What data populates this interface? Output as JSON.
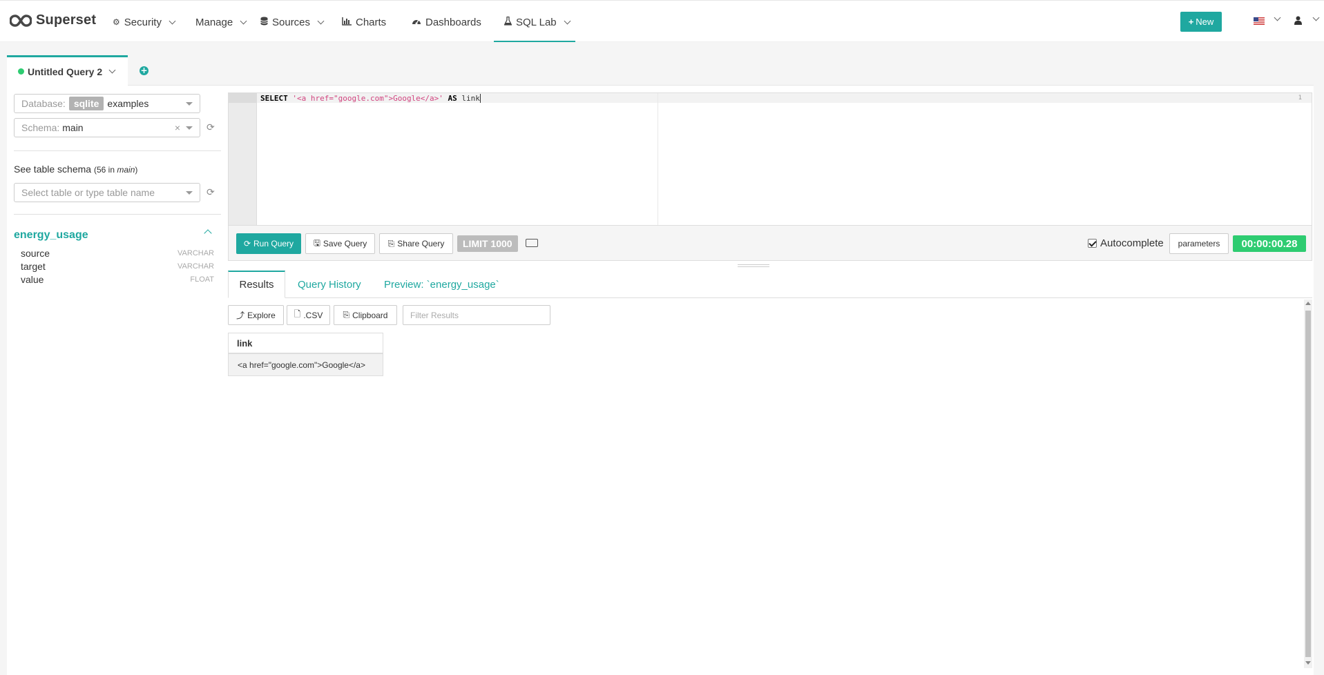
{
  "navbar": {
    "brand": "Superset",
    "items": [
      {
        "label": "Security",
        "icon": "cogs-icon"
      },
      {
        "label": "Manage",
        "icon": ""
      },
      {
        "label": "Sources",
        "icon": "database-icon"
      },
      {
        "label": "Charts",
        "icon": "bar-chart-icon"
      },
      {
        "label": "Dashboards",
        "icon": "dashboard-icon"
      },
      {
        "label": "SQL Lab",
        "icon": "flask-icon"
      }
    ],
    "new_label": "New",
    "accent_color": "#1fa8a0"
  },
  "query_tab": {
    "title": "Untitled Query 2",
    "status_color": "#2ecc71"
  },
  "left_panel": {
    "database_placeholder": "Database:",
    "database_backend": "sqlite",
    "database_name": "examples",
    "schema_placeholder": "Schema:",
    "schema_value": "main",
    "schema_clear": "×",
    "see_table_schema": "See table schema",
    "table_count": "56",
    "table_count_in": "in",
    "table_count_schema": "main",
    "table_select_placeholder": "Select table or type table name",
    "table": {
      "name": "energy_usage",
      "columns": [
        {
          "name": "source",
          "type": "VARCHAR"
        },
        {
          "name": "target",
          "type": "VARCHAR"
        },
        {
          "name": "value",
          "type": "FLOAT"
        }
      ]
    }
  },
  "editor": {
    "line_number": "1",
    "code": {
      "kw1": "SELECT",
      "string": "'<a href=\"google.com\">Google</a>'",
      "kw2": "AS",
      "ident": "link"
    }
  },
  "toolbar": {
    "run_label": "Run Query",
    "save_label": "Save Query",
    "share_label": "Share Query",
    "limit_label": "LIMIT 1000",
    "autocomplete_label": "Autocomplete",
    "autocomplete_checked": true,
    "parameters_label": "parameters",
    "timer": "00:00:00.28"
  },
  "results": {
    "tabs": [
      "Results",
      "Query History",
      "Preview: `energy_usage`"
    ],
    "explore_label": "Explore",
    "csv_label": ".CSV",
    "clipboard_label": "Clipboard",
    "filter_placeholder": "Filter Results",
    "columns": [
      "link"
    ],
    "rows": [
      [
        "<a href=\"google.com\">Google</a>"
      ]
    ]
  }
}
